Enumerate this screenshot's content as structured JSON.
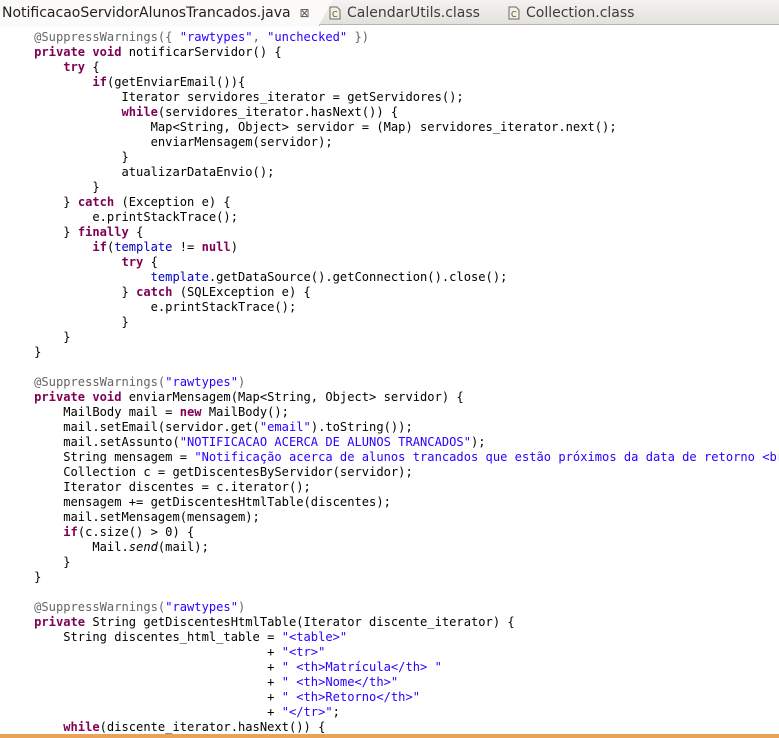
{
  "tabs": [
    {
      "label": "NotificacaoServidorAlunosTrancados.java",
      "active": true,
      "close": "⊠"
    },
    {
      "label": "CalendarUtils.class",
      "active": false
    },
    {
      "label": "Collection.class",
      "active": false
    }
  ],
  "colors": {
    "keyword": "#7f0055",
    "string": "#2a00ff",
    "annotation": "#646464",
    "field": "#0000c0",
    "accent_bar": "#e8a25a"
  },
  "code_lines": [
    [
      [
        "ann",
        "    @SuppressWarnings({ "
      ],
      [
        "str",
        "\"rawtypes\""
      ],
      [
        "ann",
        ", "
      ],
      [
        "str",
        "\"unchecked\""
      ],
      [
        "ann",
        " })"
      ]
    ],
    [
      [
        "kw",
        "    private void "
      ],
      [
        "t",
        "notificarServidor() {"
      ]
    ],
    [
      [
        "kw",
        "        try "
      ],
      [
        "t",
        "{"
      ]
    ],
    [
      [
        "kw",
        "            if"
      ],
      [
        "t",
        "(getEnviarEmail()){"
      ]
    ],
    [
      [
        "t",
        "                Iterator servidores_iterator = getServidores();"
      ]
    ],
    [
      [
        "kw",
        "                while"
      ],
      [
        "t",
        "(servidores_iterator.hasNext()) {"
      ]
    ],
    [
      [
        "t",
        "                    Map<String, Object> servidor = (Map) servidores_iterator.next();"
      ]
    ],
    [
      [
        "t",
        "                    enviarMensagem(servidor);"
      ]
    ],
    [
      [
        "t",
        "                }"
      ]
    ],
    [
      [
        "t",
        "                atualizarDataEnvio();"
      ]
    ],
    [
      [
        "t",
        "            }"
      ]
    ],
    [
      [
        "t",
        "        } "
      ],
      [
        "kw",
        "catch "
      ],
      [
        "t",
        "(Exception e) {"
      ]
    ],
    [
      [
        "t",
        "            e.printStackTrace();"
      ]
    ],
    [
      [
        "t",
        "        } "
      ],
      [
        "kw",
        "finally "
      ],
      [
        "t",
        "{"
      ]
    ],
    [
      [
        "kw",
        "            if"
      ],
      [
        "t",
        "("
      ],
      [
        "fld",
        "template"
      ],
      [
        "t",
        " != "
      ],
      [
        "kw",
        "null"
      ],
      [
        "t",
        ")"
      ]
    ],
    [
      [
        "kw",
        "                try "
      ],
      [
        "t",
        "{"
      ]
    ],
    [
      [
        "fld",
        "                    template"
      ],
      [
        "t",
        ".getDataSource().getConnection().close();"
      ]
    ],
    [
      [
        "t",
        "                } "
      ],
      [
        "kw",
        "catch "
      ],
      [
        "t",
        "(SQLException e) {"
      ]
    ],
    [
      [
        "t",
        "                    e.printStackTrace();"
      ]
    ],
    [
      [
        "t",
        "                }"
      ]
    ],
    [
      [
        "t",
        "        }"
      ]
    ],
    [
      [
        "t",
        "    }"
      ]
    ],
    [
      [
        "t",
        ""
      ]
    ],
    [
      [
        "ann",
        "    @SuppressWarnings("
      ],
      [
        "str",
        "\"rawtypes\""
      ],
      [
        "ann",
        ")"
      ]
    ],
    [
      [
        "kw",
        "    private void "
      ],
      [
        "t",
        "enviarMensagem(Map<String, Object> servidor) {"
      ]
    ],
    [
      [
        "t",
        "        MailBody mail = "
      ],
      [
        "kw",
        "new "
      ],
      [
        "t",
        "MailBody();"
      ]
    ],
    [
      [
        "t",
        "        mail.setEmail(servidor.get("
      ],
      [
        "str",
        "\"email\""
      ],
      [
        "t",
        ").toString());"
      ]
    ],
    [
      [
        "t",
        "        mail.setAssunto("
      ],
      [
        "str",
        "\"NOTIFICACAO ACERCA DE ALUNOS TRANCADOS\""
      ],
      [
        "t",
        ");"
      ]
    ],
    [
      [
        "t",
        "        String mensagem = "
      ],
      [
        "str",
        "\"Notificação acerca de alunos trancados que estão próximos da data de retorno <br/>\""
      ],
      [
        "t",
        ";"
      ]
    ],
    [
      [
        "t",
        "        Collection c = getDiscentesByServidor(servidor);"
      ]
    ],
    [
      [
        "t",
        "        Iterator discentes = c.iterator();"
      ]
    ],
    [
      [
        "t",
        "        mensagem += getDiscentesHtmlTable(discentes);"
      ]
    ],
    [
      [
        "t",
        "        mail.setMensagem(mensagem);"
      ]
    ],
    [
      [
        "kw",
        "        if"
      ],
      [
        "t",
        "(c.size() > 0) {"
      ]
    ],
    [
      [
        "t",
        "            Mail."
      ],
      [
        "ital",
        "send"
      ],
      [
        "t",
        "(mail);"
      ]
    ],
    [
      [
        "t",
        "        }"
      ]
    ],
    [
      [
        "t",
        "    }"
      ]
    ],
    [
      [
        "t",
        ""
      ]
    ],
    [
      [
        "ann",
        "    @SuppressWarnings("
      ],
      [
        "str",
        "\"rawtypes\""
      ],
      [
        "ann",
        ")"
      ]
    ],
    [
      [
        "kw",
        "    private "
      ],
      [
        "t",
        "String getDiscentesHtmlTable(Iterator discente_iterator) {"
      ]
    ],
    [
      [
        "t",
        "        String discentes_html_table = "
      ],
      [
        "str",
        "\"<table>\""
      ]
    ],
    [
      [
        "t",
        "                                    + "
      ],
      [
        "str",
        "\"<tr>\""
      ]
    ],
    [
      [
        "t",
        "                                    + "
      ],
      [
        "str",
        "\" <th>Matrícula</th> \""
      ]
    ],
    [
      [
        "t",
        "                                    + "
      ],
      [
        "str",
        "\" <th>Nome</th>\""
      ]
    ],
    [
      [
        "t",
        "                                    + "
      ],
      [
        "str",
        "\" <th>Retorno</th>\""
      ]
    ],
    [
      [
        "t",
        "                                    + "
      ],
      [
        "str",
        "\"</tr>\""
      ],
      [
        "t",
        ";"
      ]
    ],
    [
      [
        "kw",
        "        while"
      ],
      [
        "t",
        "(discente_iterator.hasNext()) {"
      ]
    ]
  ]
}
